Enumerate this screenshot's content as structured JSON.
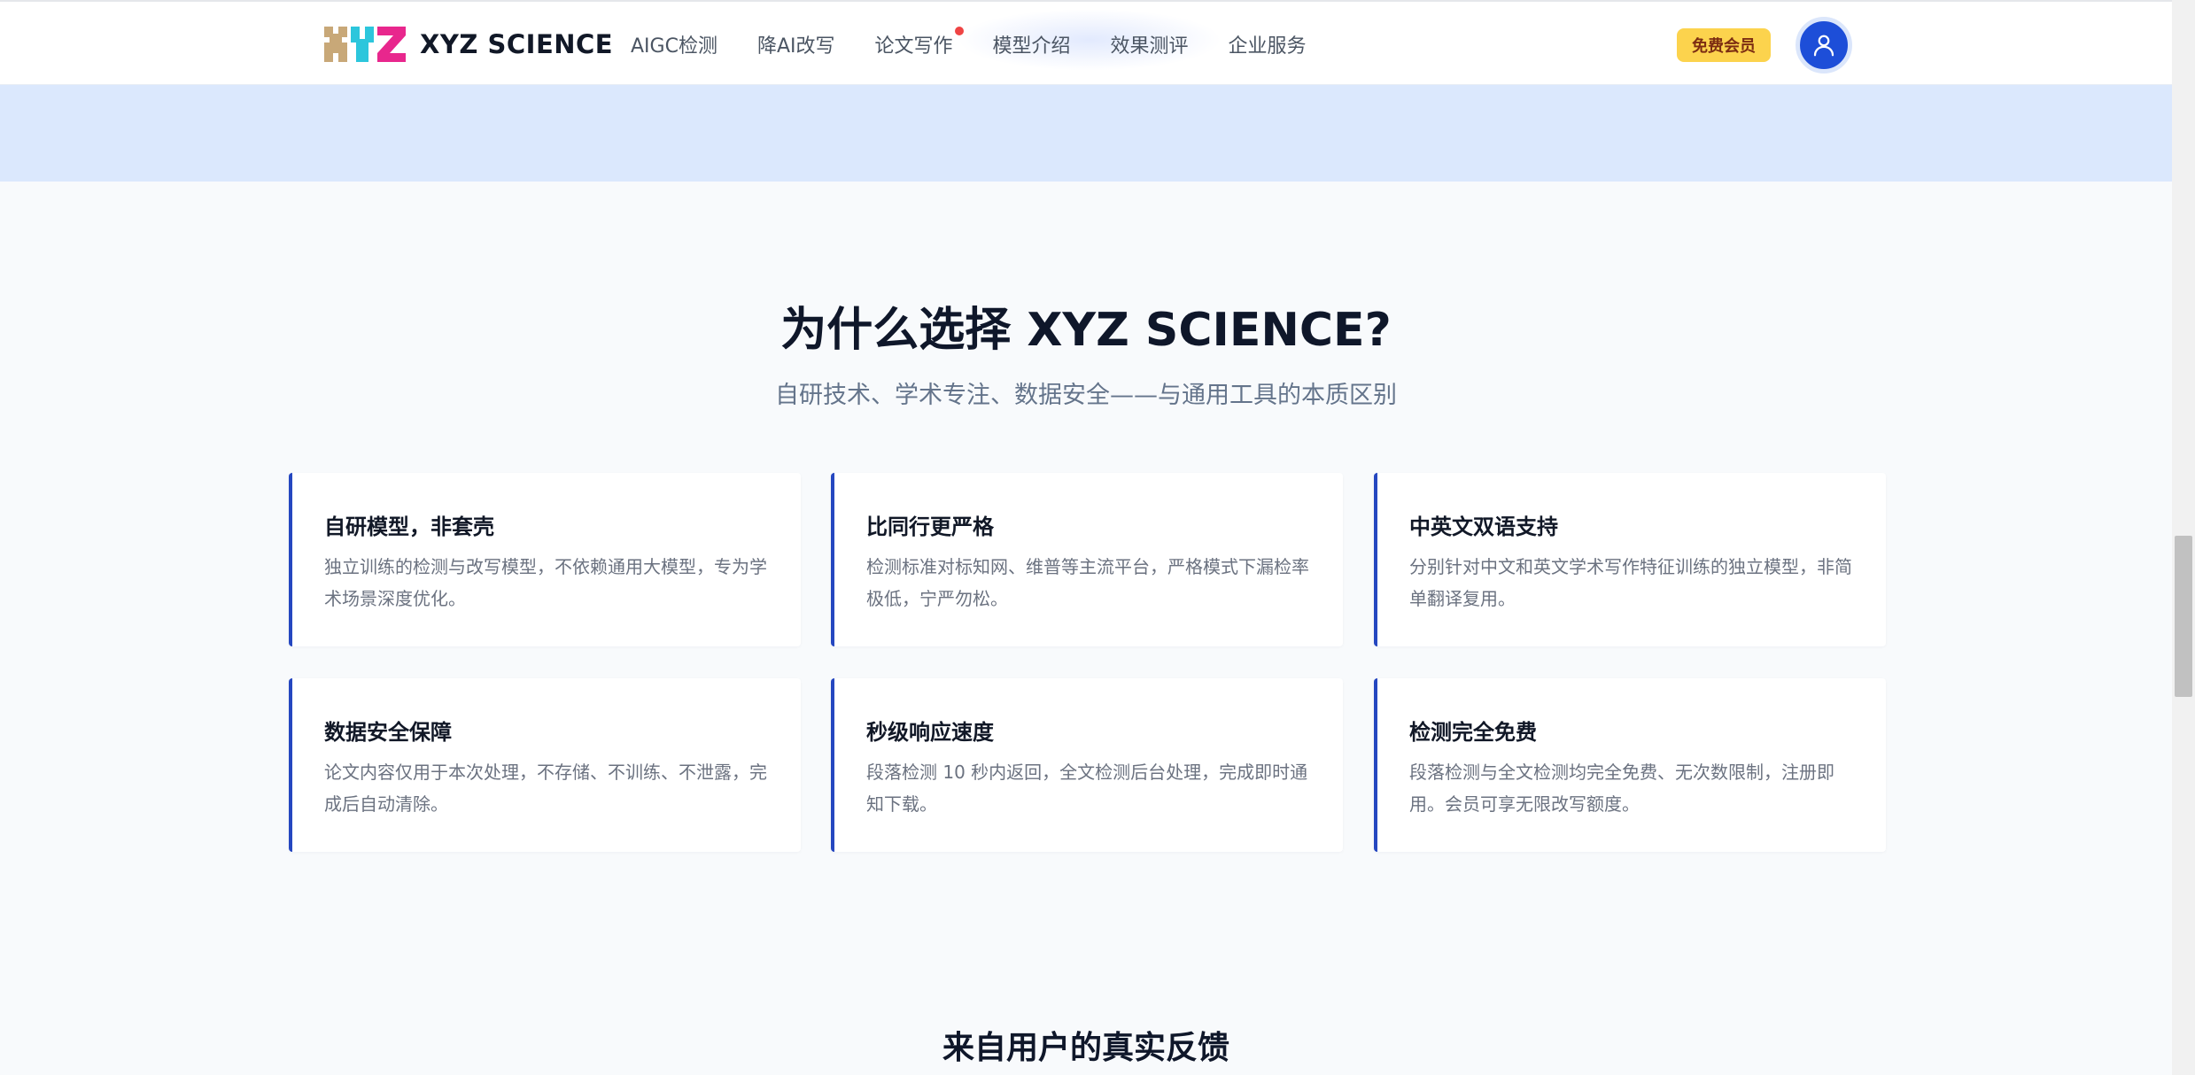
{
  "header": {
    "brand": "XYZ SCIENCE",
    "nav": [
      {
        "label": "AIGC检测"
      },
      {
        "label": "降AI改写"
      },
      {
        "label": "论文写作",
        "has_dot": true
      },
      {
        "label": "模型介绍"
      },
      {
        "label": "效果测评"
      },
      {
        "label": "企业服务"
      }
    ],
    "vip_label": "免费会员",
    "avatar_icon": "user-icon"
  },
  "colors": {
    "accent": "#2547c0",
    "band": "#dbe8fd",
    "vip": "#fcd34d",
    "dot": "#ef4444"
  },
  "why": {
    "title": "为什么选择 XYZ SCIENCE?",
    "subtitle": "自研技术、学术专注、数据安全——与通用工具的本质区别",
    "cards": [
      {
        "title": "自研模型，非套壳",
        "desc": "独立训练的检测与改写模型，不依赖通用大模型，专为学术场景深度优化。"
      },
      {
        "title": "比同行更严格",
        "desc": "检测标准对标知网、维普等主流平台，严格模式下漏检率极低，宁严勿松。"
      },
      {
        "title": "中英文双语支持",
        "desc": "分别针对中文和英文学术写作特征训练的独立模型，非简单翻译复用。"
      },
      {
        "title": "数据安全保障",
        "desc": "论文内容仅用于本次处理，不存储、不训练、不泄露，完成后自动清除。"
      },
      {
        "title": "秒级响应速度",
        "desc": "段落检测 10 秒内返回，全文检测后台处理，完成即时通知下载。"
      },
      {
        "title": "检测完全免费",
        "desc": "段落检测与全文检测均完全免费、无次数限制，注册即用。会员可享无限改写额度。"
      }
    ]
  },
  "feedback": {
    "title": "来自用户的真实反馈"
  }
}
